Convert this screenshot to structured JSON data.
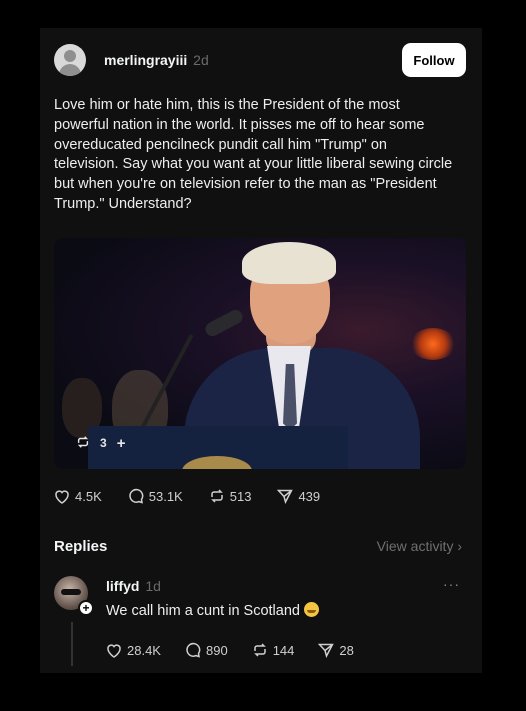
{
  "post": {
    "username": "merlingrayiii",
    "time": "2d",
    "follow_label": "Follow",
    "text": "Love him or hate him, this is the President of the most powerful nation in the world. It pisses me off to hear some overeducated pencilneck pundit call him \"Trump\" on television.  Say what you want at your little liberal sewing circle but when you're on television refer to the man as \"President Trump.\" Understand?",
    "media": {
      "repost_count": "3",
      "plus": "+"
    },
    "stats": {
      "likes": "4.5K",
      "comments": "53.1K",
      "reposts": "513",
      "shares": "439"
    }
  },
  "replies": {
    "label": "Replies",
    "view_activity": "View activity ›",
    "items": [
      {
        "username": "liffyd",
        "time": "1d",
        "text": "We call him a cunt in Scotland",
        "more": "···",
        "stats": {
          "likes": "28.4K",
          "comments": "890",
          "reposts": "144",
          "shares": "28"
        }
      }
    ]
  }
}
